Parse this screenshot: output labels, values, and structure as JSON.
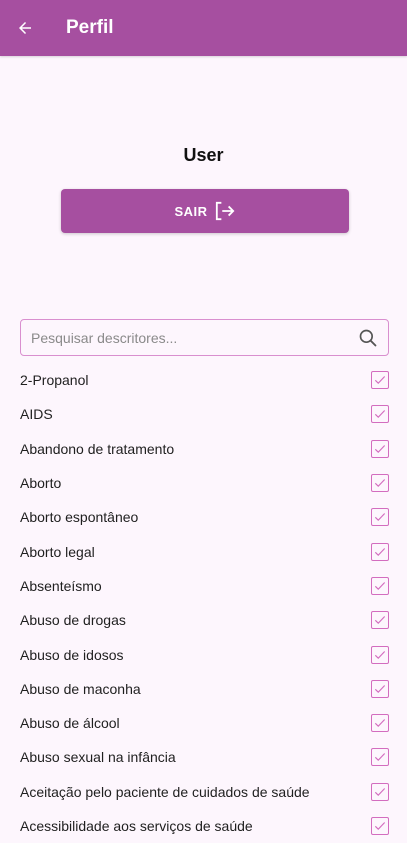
{
  "appbar": {
    "title": "Perfil",
    "back_icon": "arrow-left-icon"
  },
  "profile": {
    "user_name": "User"
  },
  "logout": {
    "label": "SAIR",
    "icon": "logout-icon"
  },
  "search": {
    "placeholder": "Pesquisar descritores...",
    "value": "",
    "icon": "search-icon"
  },
  "colors": {
    "primary": "#a64fa0",
    "accent": "#d36dbf",
    "background": "#fdf6fd"
  },
  "descriptors": [
    {
      "label": "2-Propanol",
      "checked": true
    },
    {
      "label": "AIDS",
      "checked": true
    },
    {
      "label": "Abandono de tratamento",
      "checked": true
    },
    {
      "label": "Aborto",
      "checked": true
    },
    {
      "label": "Aborto espontâneo",
      "checked": true
    },
    {
      "label": "Aborto legal",
      "checked": true
    },
    {
      "label": "Absenteísmo",
      "checked": true
    },
    {
      "label": "Abuso de drogas",
      "checked": true
    },
    {
      "label": "Abuso de idosos",
      "checked": true
    },
    {
      "label": "Abuso de maconha",
      "checked": true
    },
    {
      "label": "Abuso de álcool",
      "checked": true
    },
    {
      "label": "Abuso sexual na infância",
      "checked": true
    },
    {
      "label": "Aceitação pelo paciente de cuidados de saúde",
      "checked": true
    },
    {
      "label": "Acessibilidade aos serviços de saúde",
      "checked": true
    }
  ]
}
